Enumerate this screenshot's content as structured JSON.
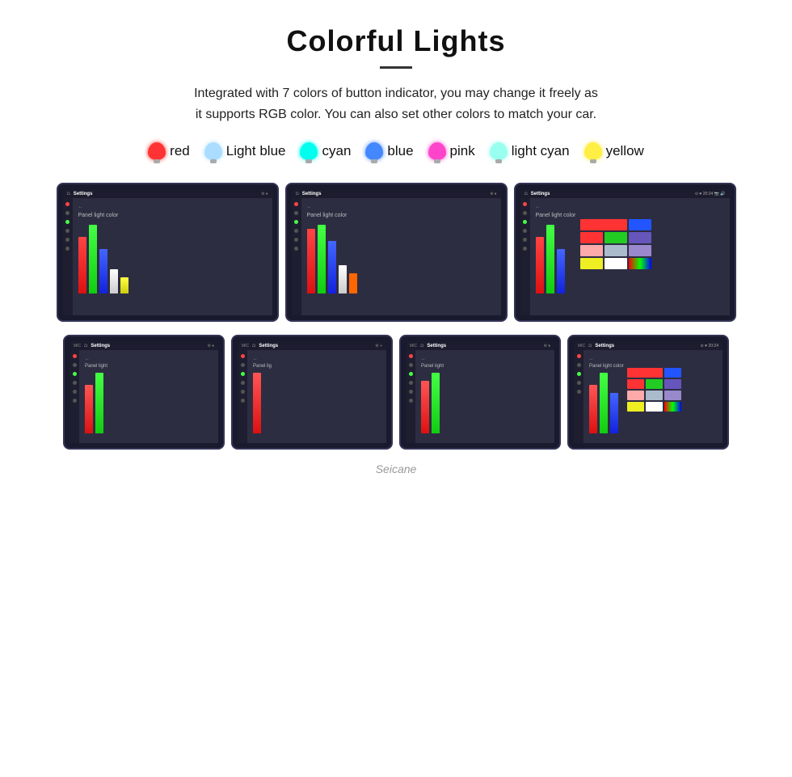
{
  "header": {
    "title": "Colorful Lights",
    "subtitle": "Integrated with 7 colors of button indicator, you may change it freely as\nit supports RGB color. You can also set other colors to match your car."
  },
  "colors": [
    {
      "name": "red",
      "class": "bulb-red"
    },
    {
      "name": "Light blue",
      "class": "bulb-lightblue"
    },
    {
      "name": "cyan",
      "class": "bulb-cyan"
    },
    {
      "name": "blue",
      "class": "bulb-blue"
    },
    {
      "name": "pink",
      "class": "bulb-pink"
    },
    {
      "name": "light cyan",
      "class": "bulb-lightcyan"
    },
    {
      "name": "yellow",
      "class": "bulb-yellow"
    }
  ],
  "watermark": "Seicane",
  "topbar": {
    "settings": "Settings"
  }
}
